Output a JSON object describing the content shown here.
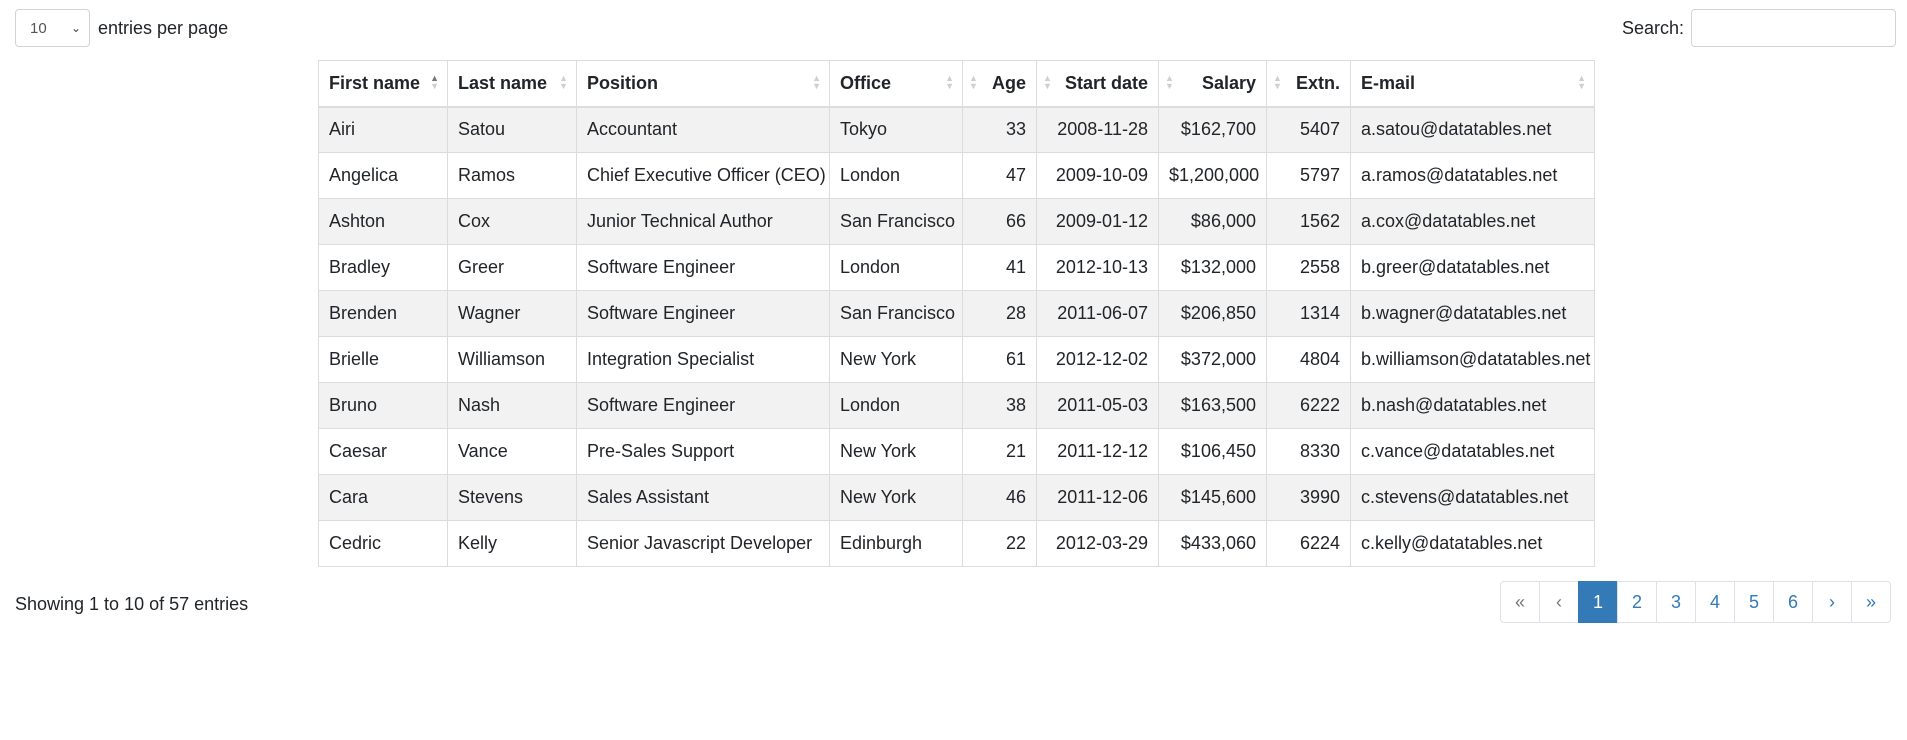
{
  "length": {
    "value": "10",
    "label": "entries per page"
  },
  "search": {
    "label": "Search:",
    "value": ""
  },
  "table": {
    "headers": [
      "First name",
      "Last name",
      "Position",
      "Office",
      "Age",
      "Start date",
      "Salary",
      "Extn.",
      "E-mail"
    ],
    "sort_column": "First name",
    "sort_direction": "ascending",
    "rows": [
      [
        "Airi",
        "Satou",
        "Accountant",
        "Tokyo",
        "33",
        "2008-11-28",
        "$162,700",
        "5407",
        "a.satou@datatables.net"
      ],
      [
        "Angelica",
        "Ramos",
        "Chief Executive Officer (CEO)",
        "London",
        "47",
        "2009-10-09",
        "$1,200,000",
        "5797",
        "a.ramos@datatables.net"
      ],
      [
        "Ashton",
        "Cox",
        "Junior Technical Author",
        "San Francisco",
        "66",
        "2009-01-12",
        "$86,000",
        "1562",
        "a.cox@datatables.net"
      ],
      [
        "Bradley",
        "Greer",
        "Software Engineer",
        "London",
        "41",
        "2012-10-13",
        "$132,000",
        "2558",
        "b.greer@datatables.net"
      ],
      [
        "Brenden",
        "Wagner",
        "Software Engineer",
        "San Francisco",
        "28",
        "2011-06-07",
        "$206,850",
        "1314",
        "b.wagner@datatables.net"
      ],
      [
        "Brielle",
        "Williamson",
        "Integration Specialist",
        "New York",
        "61",
        "2012-12-02",
        "$372,000",
        "4804",
        "b.williamson@datatables.net"
      ],
      [
        "Bruno",
        "Nash",
        "Software Engineer",
        "London",
        "38",
        "2011-05-03",
        "$163,500",
        "6222",
        "b.nash@datatables.net"
      ],
      [
        "Caesar",
        "Vance",
        "Pre-Sales Support",
        "New York",
        "21",
        "2011-12-12",
        "$106,450",
        "8330",
        "c.vance@datatables.net"
      ],
      [
        "Cara",
        "Stevens",
        "Sales Assistant",
        "New York",
        "46",
        "2011-12-06",
        "$145,600",
        "3990",
        "c.stevens@datatables.net"
      ],
      [
        "Cedric",
        "Kelly",
        "Senior Javascript Developer",
        "Edinburgh",
        "22",
        "2012-03-29",
        "$433,060",
        "6224",
        "c.kelly@datatables.net"
      ]
    ]
  },
  "info": "Showing 1 to 10 of 57 entries",
  "pagination": {
    "first": "«",
    "prev": "‹",
    "pages": [
      "1",
      "2",
      "3",
      "4",
      "5",
      "6"
    ],
    "current": "1",
    "next": "›",
    "last": "»"
  },
  "colors": {
    "accent": "#337ab7",
    "stripe": "#f2f2f2",
    "border": "#dcdcdc"
  }
}
